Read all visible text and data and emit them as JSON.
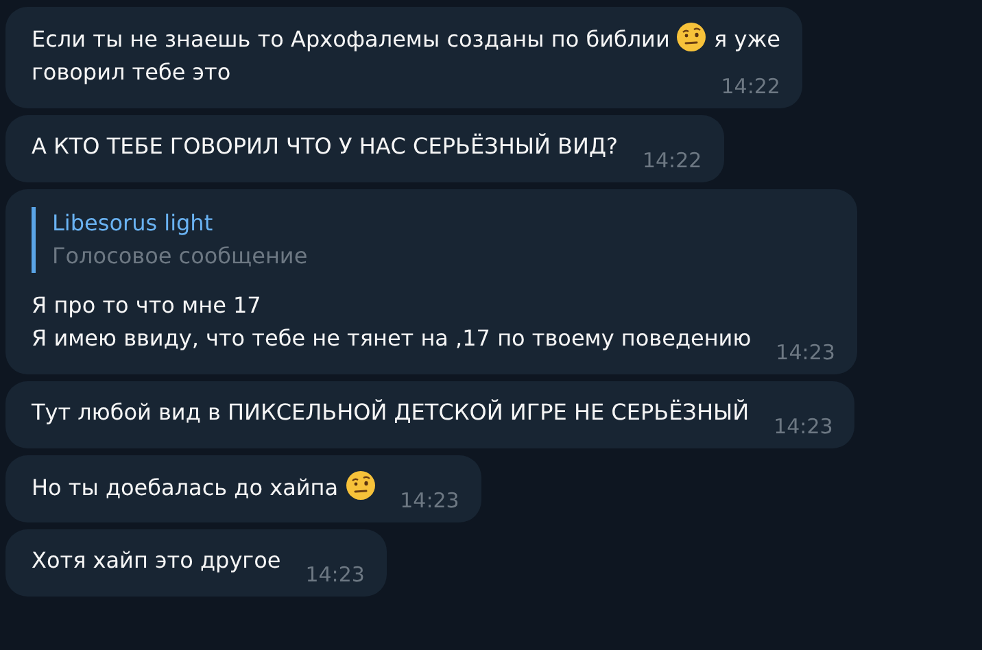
{
  "messages": [
    {
      "parts": [
        {
          "kind": "text",
          "text": "Если ты не знаешь то Архофалемы созданы по библии "
        },
        {
          "kind": "emoji"
        },
        {
          "kind": "text",
          "text": " я уже"
        },
        {
          "kind": "break"
        },
        {
          "kind": "text",
          "text": "говорил тебе это"
        }
      ],
      "time": "14:22"
    },
    {
      "parts": [
        {
          "kind": "text",
          "text": "А КТО ТЕБЕ ГОВОРИЛ ЧТО У НАС СЕРЬЁЗНЫЙ ВИД?"
        }
      ],
      "time": "14:22"
    },
    {
      "reply": {
        "author": "Libesorus light",
        "preview": "Голосовое сообщение"
      },
      "parts": [
        {
          "kind": "text",
          "text": "Я про то что мне 17"
        },
        {
          "kind": "break"
        },
        {
          "kind": "text",
          "text": "Я имею ввиду, что тебе не тянет на ,17 по твоему поведению"
        }
      ],
      "time": "14:23"
    },
    {
      "parts": [
        {
          "kind": "text",
          "text": "Тут любой вид в ПИКСЕЛЬНОЙ ДЕТСКОЙ ИГРЕ НЕ СЕРЬЁЗНЫЙ"
        }
      ],
      "time": "14:23"
    },
    {
      "parts": [
        {
          "kind": "text",
          "text": "Но ты доебалась до хайпа "
        },
        {
          "kind": "emoji"
        }
      ],
      "time": "14:23"
    },
    {
      "parts": [
        {
          "kind": "text",
          "text": "Хотя хайп это другое"
        }
      ],
      "time": "14:23"
    }
  ]
}
